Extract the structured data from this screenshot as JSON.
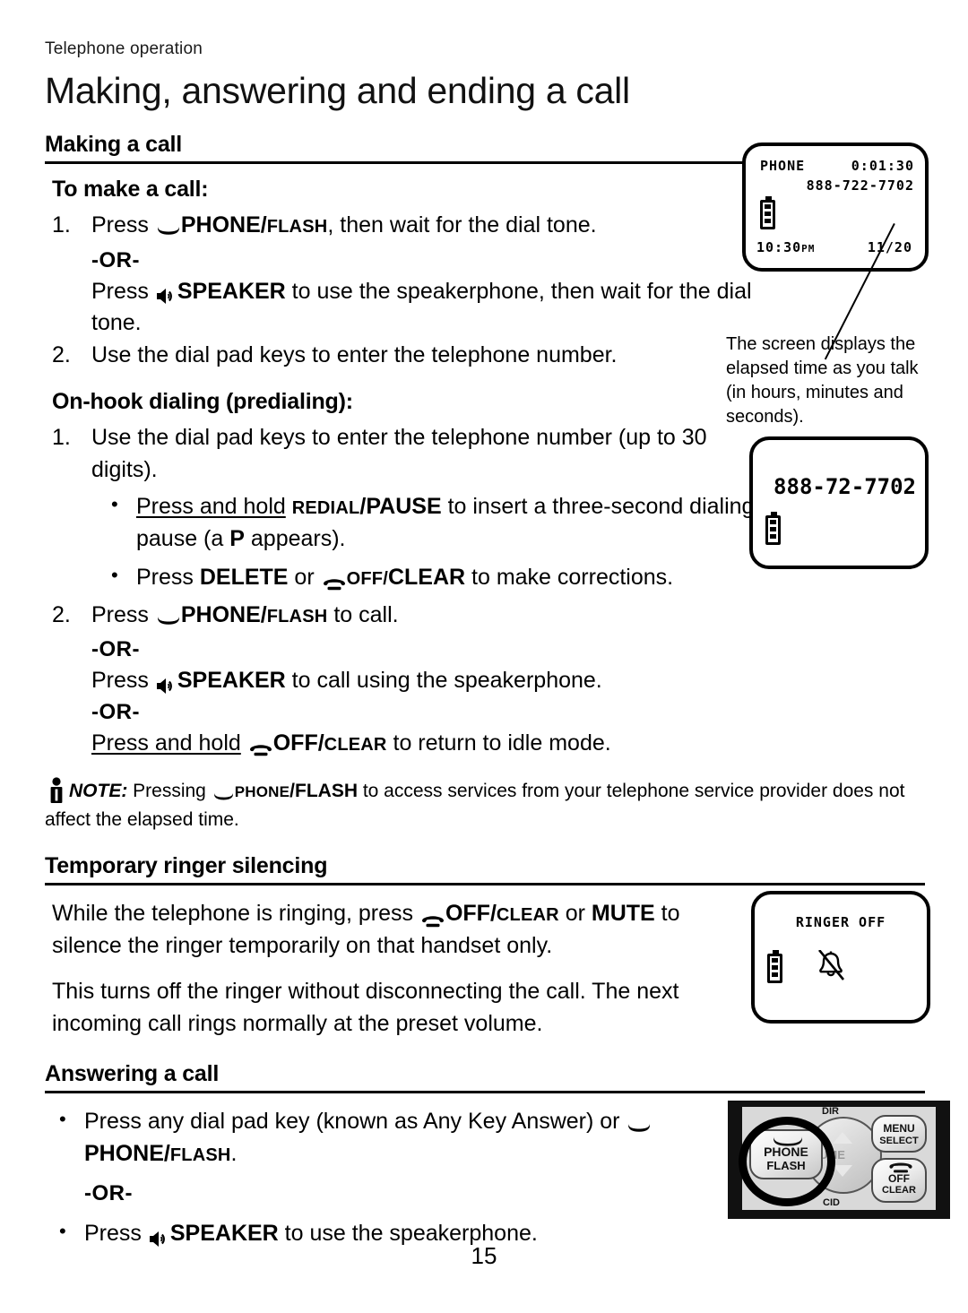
{
  "running_head": "Telephone operation",
  "page_title": "Making, answering and ending a call",
  "page_number": "15",
  "sections": {
    "making_a_call": {
      "heading": "Making a call",
      "to_make_a_call": {
        "heading": "To make a call:",
        "step1_num": "1.",
        "step1_pre": "Press ",
        "step1_key_big": "PHONE/",
        "step1_key_small": "FLASH",
        "step1_post": ", then wait for the dial tone.",
        "or1": "-OR-",
        "alt_pre": "Press ",
        "alt_key": "SPEAKER",
        "alt_post": " to use the speakerphone, then wait for the dial tone.",
        "step2_num": "2.",
        "step2_text": "Use the dial pad keys to enter the telephone number."
      },
      "on_hook": {
        "heading": "On-hook dialing (predialing):",
        "step1_num": "1.",
        "step1_text": "Use the dial pad keys to enter the telephone number (up to 30 digits).",
        "bullet1_underlined": "Press and hold",
        "bullet1_key_small": "REDIAL",
        "bullet1_key_big": "/PAUSE",
        "bullet1_mid": " to insert a three-second dialing pause (a ",
        "bullet1_p": "P",
        "bullet1_end": " appears).",
        "bullet2_pre": "Press ",
        "bullet2_delete": "DELETE",
        "bullet2_or": " or ",
        "bullet2_key_small": "OFF/",
        "bullet2_key_big": "CLEAR",
        "bullet2_post": " to make corrections.",
        "step2_num": "2.",
        "step2_pre": "Press ",
        "step2_key_big": "PHONE/",
        "step2_key_small": "FLASH",
        "step2_post": " to call.",
        "or1": "-OR-",
        "alt1_pre": "Press ",
        "alt1_key": "SPEAKER",
        "alt1_post": " to call using the speakerphone.",
        "or2": "-OR-",
        "alt2_underlined": "Press and hold",
        "alt2_key_big": "OFF/",
        "alt2_key_small": "CLEAR",
        "alt2_post": " to return to idle mode."
      },
      "note": {
        "label": "NOTE:",
        "pre": " Pressing ",
        "key_small": "PHONE",
        "key_big": "/FLASH",
        "post": " to access services from your telephone service provider does not affect the elapsed time."
      }
    },
    "temporary_ringer_silencing": {
      "heading": "Temporary ringer silencing",
      "p1_pre": "While the telephone is ringing, press ",
      "p1_key_big": "OFF/",
      "p1_key_small": "CLEAR",
      "p1_mid": " or ",
      "p1_mute": "MUTE",
      "p1_post": " to silence the ringer temporarily on that handset only.",
      "p2": "This turns off the ringer without disconnecting the call. The next incoming call rings normally at the preset volume."
    },
    "answering_a_call": {
      "heading": "Answering a call",
      "bullet1_pre": "Press any dial pad key (known as Any Key Answer) or ",
      "bullet1_key_big": "PHONE/",
      "bullet1_key_small": "FLASH",
      "bullet1_post": ".",
      "or": "-OR-",
      "bullet2_pre": "Press ",
      "bullet2_key": "SPEAKER",
      "bullet2_post": " to use the speakerphone."
    }
  },
  "lcd_screens": {
    "in_call": {
      "status": "PHONE",
      "elapsed_time": "0:01:30",
      "number": "888-722-7702",
      "clock": "10:30",
      "clock_meridiem": "PM",
      "date": "11/20"
    },
    "predial": {
      "number": "888-72-7702"
    },
    "ringer_off": {
      "label": "RINGER OFF"
    }
  },
  "captions": {
    "elapsed_time": "The screen displays the elapsed time as you talk (in hours, minutes and seconds)."
  },
  "keypad": {
    "dir": "DIR",
    "cid": "CID",
    "volume": "UME",
    "phone_line1": "PHONE",
    "phone_line2": "FLASH",
    "menu_line1": "MENU",
    "menu_line2": "SELECT",
    "off_line1": "OFF",
    "off_line2": "CLEAR"
  }
}
